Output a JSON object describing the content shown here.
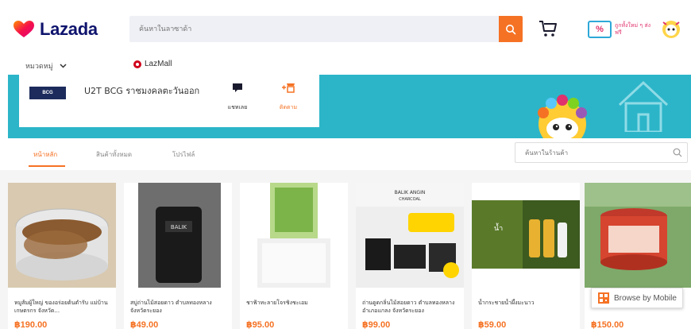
{
  "header": {
    "logo_text": "Lazada",
    "search_placeholder": "ค้นหาในลาซาด้า",
    "promo_badge": "%",
    "promo_text": "ถูกทั้งใหม่ ๆ ส่งฟรี"
  },
  "subnav": {
    "category_label": "หมวดหมู่",
    "lazmall_label": "LazMall"
  },
  "store": {
    "logo_text": "BCG",
    "name": "U2T BCG ราชมงคลตะวันออก",
    "chat_label": "แชทเลย",
    "follow_label": "ติดตาม"
  },
  "tabs": {
    "items": [
      "หน้าหลัก",
      "สินค้าทั้งหมด",
      "โปรไฟล์"
    ],
    "store_search_placeholder": "ค้นหาในร้านค้า"
  },
  "products": [
    {
      "title": "หมูส้มผู้ใหญ่ ของอร่อยต้นตำรับ แม่บ้านเกษตรกร จังหวัด...",
      "price": "฿190.00"
    },
    {
      "title": "สบู่ถ่านไม้สอยดาว ตำบลทองหลาง จังหวัดระยอง",
      "price": "฿49.00"
    },
    {
      "title": "ชาฟ้าทะลายโจรชิงชะเอม",
      "price": "฿95.00"
    },
    {
      "title": "ถ่านดูดกลิ่นไม้สอยดาว ตำบลทองหลาง อำเภอแกลง จังหวัดระยอง",
      "price": "฿99.00"
    },
    {
      "title": "น้ำกระชายน้ำผึ้งมะนาว",
      "price": "฿59.00"
    },
    {
      "title": "น้ำพริก... จังหวัดระยอง",
      "price": "฿150.00"
    }
  ],
  "browse_mobile": "Browse by Mobile",
  "colors": {
    "accent": "#f57224",
    "banner": "#2cb5c9",
    "brand_navy": "#0f146d"
  }
}
